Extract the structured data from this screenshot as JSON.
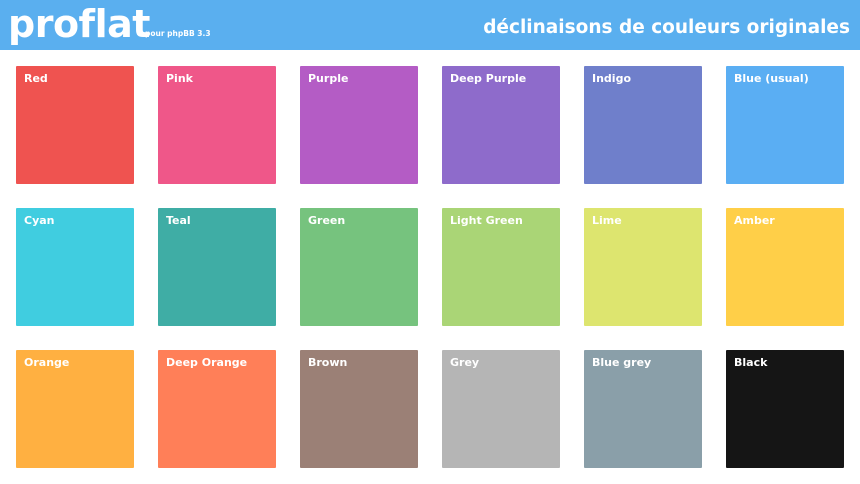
{
  "header": {
    "logo": "proflat",
    "tagline": "pour phpBB 3.3",
    "subtitle": "déclinaisons de couleurs originales",
    "background": "#5aafef"
  },
  "swatches": [
    {
      "label": "Red",
      "color": "#ef5350"
    },
    {
      "label": "Pink",
      "color": "#ef5789"
    },
    {
      "label": "Purple",
      "color": "#b45cc5"
    },
    {
      "label": "Deep Purple",
      "color": "#8e6bcb"
    },
    {
      "label": "Indigo",
      "color": "#6f7fcb"
    },
    {
      "label": "Blue (usual)",
      "color": "#5aaef3"
    },
    {
      "label": "Cyan",
      "color": "#40cde0"
    },
    {
      "label": "Teal",
      "color": "#3fada5"
    },
    {
      "label": "Green",
      "color": "#76c37e"
    },
    {
      "label": "Light Green",
      "color": "#aad576"
    },
    {
      "label": "Lime",
      "color": "#dde56f"
    },
    {
      "label": "Amber",
      "color": "#ffcf48"
    },
    {
      "label": "Orange",
      "color": "#ffb041"
    },
    {
      "label": "Deep Orange",
      "color": "#ff7f58"
    },
    {
      "label": "Brown",
      "color": "#9b8076"
    },
    {
      "label": "Grey",
      "color": "#b5b5b5"
    },
    {
      "label": "Blue grey",
      "color": "#8a9fa9"
    },
    {
      "label": "Black",
      "color": "#151515"
    }
  ]
}
